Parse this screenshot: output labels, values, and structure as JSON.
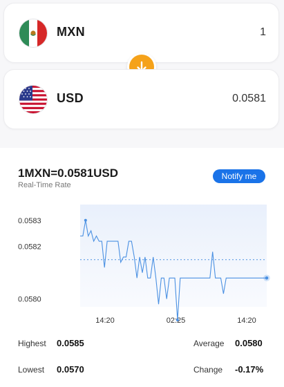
{
  "from": {
    "code": "MXN",
    "amount": "1",
    "flag": "mexico-flag"
  },
  "to": {
    "code": "USD",
    "amount": "0.0581",
    "flag": "usa-flag"
  },
  "swap": {
    "icon": "arrow-down-icon",
    "color": "#f5a21a"
  },
  "rate": {
    "title": "1MXN=0.0581USD",
    "subtitle": "Real-Time Rate",
    "notify_label": "Notify me"
  },
  "chart_data": {
    "type": "line",
    "y_ticks": [
      "0.0583",
      "0.0582",
      "0.0580"
    ],
    "x_ticks": [
      "14:20",
      "02:25",
      "14:20"
    ],
    "ylim": [
      0.05797,
      0.05836
    ],
    "reference_line": 0.05815,
    "values": [
      0.05824,
      0.05824,
      0.0583,
      0.05824,
      0.05826,
      0.05822,
      0.05824,
      0.05822,
      0.05822,
      0.05812,
      0.05822,
      0.05822,
      0.05822,
      0.05822,
      0.05822,
      0.05814,
      0.05816,
      0.05816,
      0.05822,
      0.05822,
      0.05816,
      0.05808,
      0.05816,
      0.0581,
      0.05816,
      0.05808,
      0.05808,
      0.05816,
      0.05808,
      0.05798,
      0.05808,
      0.05808,
      0.058,
      0.05808,
      0.05808,
      0.05808,
      0.05792,
      0.05808,
      0.05808,
      0.05808,
      0.05808,
      0.05808,
      0.05808,
      0.05808,
      0.05808,
      0.05808,
      0.05808,
      0.05808,
      0.05808,
      0.05818,
      0.05808,
      0.05808,
      0.05808,
      0.05802,
      0.05808,
      0.05808,
      0.05808,
      0.05808,
      0.05808,
      0.05808,
      0.05808,
      0.05808,
      0.05808,
      0.05808,
      0.05808,
      0.05808,
      0.05808,
      0.05808,
      0.05808,
      0.05808
    ],
    "line_color": "#4a90e2",
    "grid": false
  },
  "stats": {
    "highest_label": "Highest",
    "highest_value": "0.0585",
    "average_label": "Average",
    "average_value": "0.0580",
    "lowest_label": "Lowest",
    "lowest_value": "0.0570",
    "change_label": "Change",
    "change_value": "-0.17%"
  }
}
